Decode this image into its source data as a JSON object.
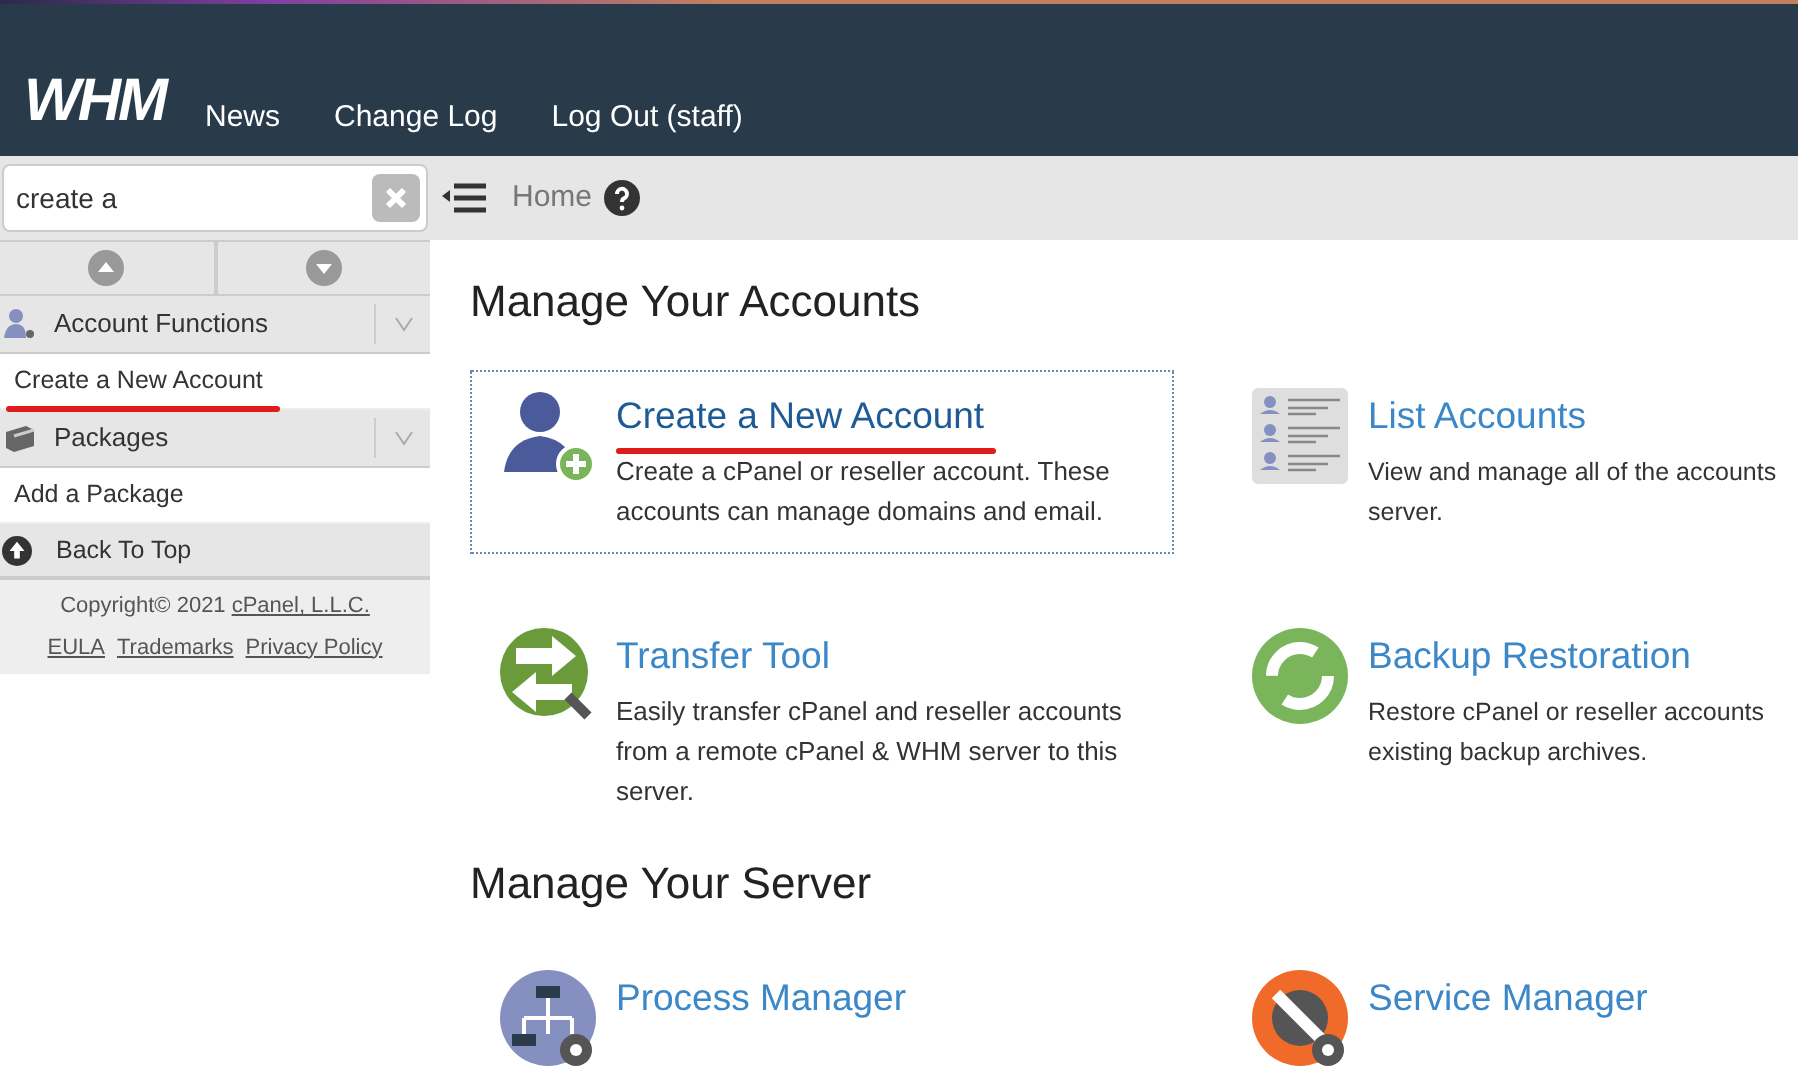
{
  "header": {
    "logo": "WHM",
    "nav": [
      "News",
      "Change Log",
      "Log Out (staff)"
    ]
  },
  "search": {
    "value": "create a"
  },
  "breadcrumb": {
    "label": "Home"
  },
  "sidebar": {
    "groups": [
      {
        "title": "Account Functions",
        "kind": "user",
        "items": [
          {
            "label": "Create a New Account",
            "marked": true
          }
        ]
      },
      {
        "title": "Packages",
        "kind": "package",
        "items": [
          {
            "label": "Add a Package",
            "marked": false
          }
        ]
      }
    ],
    "back_to_top": "Back To Top",
    "copyright": "Copyright© 2021",
    "company_link": "cPanel, L.L.C.",
    "footer_links": [
      "EULA",
      "Trademarks",
      "Privacy Policy"
    ]
  },
  "sections": [
    {
      "title": "Manage Your Accounts",
      "apps": [
        {
          "kind": "user-add",
          "title": "Create a New Account",
          "description": "Create a cPanel or reseller account. These accounts can manage domains and email.",
          "selected": true,
          "marked": true
        },
        {
          "kind": "list",
          "title": "List Accounts",
          "description": "View and manage all of the accounts",
          "description_2": "server.",
          "selected": false,
          "marked": false
        },
        {
          "kind": "transfer",
          "title": "Transfer Tool",
          "description": "Easily transfer cPanel and reseller accounts from a remote cPanel & WHM server to this server.",
          "selected": false,
          "marked": false
        },
        {
          "kind": "backup",
          "title": "Backup Restoration",
          "description": "Restore cPanel or reseller accounts",
          "description_2": "existing backup archives.",
          "selected": false,
          "marked": false
        }
      ]
    },
    {
      "title": "Manage Your Server",
      "apps": [
        {
          "kind": "process",
          "title": "Process Manager",
          "selected": false,
          "marked": false
        },
        {
          "kind": "service",
          "title": "Service Manager",
          "selected": false,
          "marked": false
        }
      ]
    }
  ]
}
